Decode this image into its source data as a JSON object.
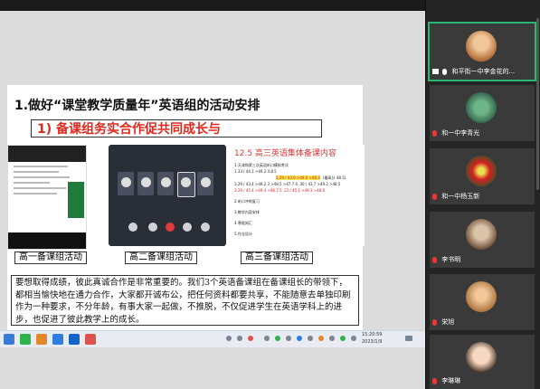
{
  "slide": {
    "title": "1.做好“课堂教学质量年”英语组的活动安排",
    "subtitle": "1) 备课组务实合作促共同成长与",
    "shot3": {
      "title": "12.5 高三英语集体备课内容",
      "rows": [
        "1.天津和第三次英语听口模拟考试",
        "1.33 / 44.1 >49.2 4.8.5",
        "3.29 / 43.4  >49.2 3 >48.5 >47.7 4 .30 / 43.7 >49.2 >48.5",
        "3.29 / 45.4 >49.4  >48.7 5 .23 / 45.1 >49.3 >48.6",
        "2.听口冲刺复习",
        "3.教学内容安排",
        "4.寒假阅汇",
        "5.作业设计"
      ],
      "highlight": "2.29 / 43.6  >49.0 >48.3",
      "highlight_note": "(最高分 48.5)"
    },
    "captions": [
      "高一备课组活动",
      "高二备课组活动",
      "高三备课组活动"
    ],
    "paragraph": "要想取得成绩，彼此真诚合作是非常重要的。我们3个英语备课组在备课组长的带领下，都相当愉快地在通力合作，大家都开诚布公，把任何资料都要共享，不能随意去单独印刷作为一种要求，不分年龄，有事大家一起做，不推脱，不仅促进学生在英语学科上的进步，也促进了彼此教学上的成长。"
  },
  "taskbar": {
    "time": "15:20:59",
    "date": "2023/1/9"
  },
  "participants": [
    {
      "name": "和平街一中李金花的..."
    },
    {
      "name": "和一中李青光"
    },
    {
      "name": "和一中杨玉新"
    },
    {
      "name": "李书明"
    },
    {
      "name": "栄旭"
    },
    {
      "name": "李琳琳"
    }
  ],
  "colors": {
    "accent_red": "#e0281e",
    "active_speaker": "#2bb673"
  }
}
